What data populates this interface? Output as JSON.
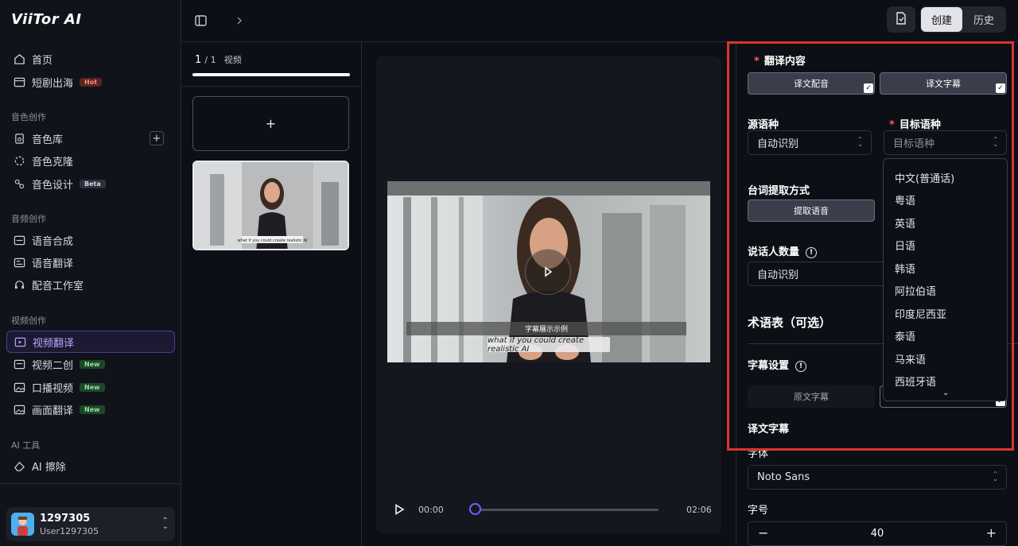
{
  "app": {
    "logo": "ViiTor AI"
  },
  "sidebar": {
    "items_top": [
      {
        "label": "首页",
        "icon": "home-icon"
      },
      {
        "label": "短剧出海",
        "icon": "film-icon",
        "badge": "Hot"
      }
    ],
    "section_voice": "音色创作",
    "voice_items": [
      {
        "label": "音色库",
        "icon": "library-icon"
      },
      {
        "label": "音色克隆",
        "icon": "clone-icon"
      },
      {
        "label": "音色设计",
        "icon": "design-icon",
        "badge": "Beta"
      }
    ],
    "section_audio": "音频创作",
    "audio_items": [
      {
        "label": "语音合成",
        "icon": "tts-icon"
      },
      {
        "label": "语音翻译",
        "icon": "translate-icon"
      },
      {
        "label": "配音工作室",
        "icon": "headset-icon"
      }
    ],
    "section_video": "视频创作",
    "video_items": [
      {
        "label": "视频翻译",
        "icon": "video-translate-icon"
      },
      {
        "label": "视频二创",
        "icon": "video-remix-icon",
        "badge": "New"
      },
      {
        "label": "口播视频",
        "icon": "image-icon",
        "badge": "New"
      },
      {
        "label": "画面翻译",
        "icon": "image-icon",
        "badge": "New"
      }
    ],
    "section_ai": "AI 工具",
    "ai_items": [
      {
        "label": "AI 擦除",
        "icon": "eraser-icon"
      }
    ],
    "user": {
      "name": "1297305",
      "sub": "User1297305"
    }
  },
  "topbar": {
    "create": "创建",
    "history": "历史"
  },
  "files": {
    "current": "1",
    "total": "/ 1",
    "unit": "视频",
    "progress": 1.0,
    "add": "+"
  },
  "player": {
    "caption_demo": "字幕展示示例",
    "subtitle": "what if you could create realistic AI",
    "time_current": "00:00",
    "time_total": "02:06",
    "position": 0.0
  },
  "settings": {
    "translate_content_label": "翻译内容",
    "opt_dub": "译文配音",
    "opt_subs": "译文字幕",
    "source_lang_label": "源语种",
    "source_lang_value": "自动识别",
    "target_lang_label": "目标语种",
    "target_lang_placeholder": "目标语种",
    "extract_label": "台词提取方式",
    "extract_value": "提取语音",
    "speakers_label": "说话人数量",
    "speakers_value": "自动识别",
    "glossary_label": "术语表（可选）",
    "subtitle_settings_label": "字幕设置",
    "orig_subs": "原文字幕",
    "trans_subs_label": "译文字幕",
    "font_label": "字体",
    "font_value": "Noto Sans",
    "size_label": "字号",
    "size_value": "40",
    "minus": "−",
    "plus": "+"
  },
  "dropdown": {
    "options": [
      "中文(普通话)",
      "粤语",
      "英语",
      "日语",
      "韩语",
      "阿拉伯语",
      "印度尼西亚",
      "泰语",
      "马来语",
      "西班牙语"
    ],
    "more": "⌄"
  },
  "colors": {
    "accent": "#7b5cff",
    "highlight": "#d9362a"
  }
}
